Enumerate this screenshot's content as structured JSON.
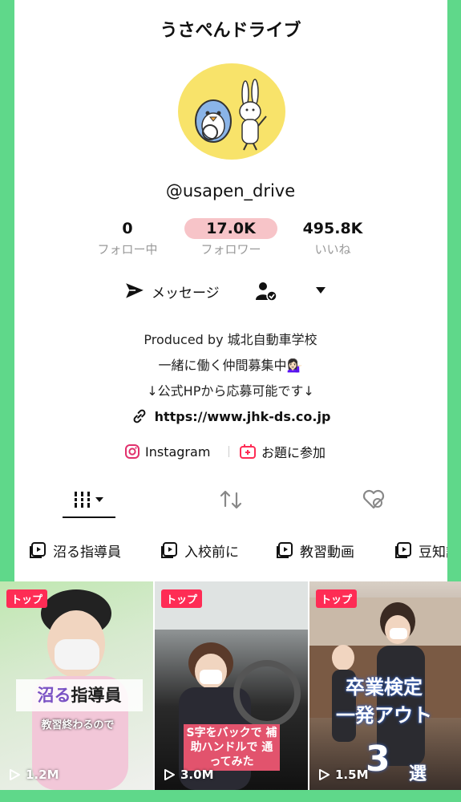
{
  "profile": {
    "display_name": "うさぺんドライブ",
    "handle": "@usapen_drive"
  },
  "stats": {
    "following": {
      "value": "0",
      "label": "フォロー中"
    },
    "followers": {
      "value": "17.0K",
      "label": "フォロワー"
    },
    "likes": {
      "value": "495.8K",
      "label": "いいね"
    }
  },
  "actions": {
    "message_label": "メッセージ"
  },
  "bio": {
    "line1": "Produced by 城北自動車学校",
    "line2": "一緒に働く仲間募集中💁🏻‍♀️",
    "line3": "↓公式HPから応募可能です↓",
    "link": "https://www.jhk-ds.co.jp"
  },
  "badges": {
    "instagram": "Instagram",
    "topic": "お題に参加"
  },
  "tabs": [
    "videos",
    "reposts",
    "liked"
  ],
  "playlists": [
    "沼る指導員",
    "入校前に",
    "教習動画",
    "豆知識"
  ],
  "videos": [
    {
      "pinned_label": "トップ",
      "views": "1.2M",
      "caption_main": "沼る",
      "caption_main2": "指導員",
      "caption_sub": "教習終わるので"
    },
    {
      "pinned_label": "トップ",
      "views": "3.0M",
      "caption_lines": "S字をバックで 補助ハンドルで 通ってみた"
    },
    {
      "pinned_label": "トップ",
      "views": "1.5M",
      "caption_line1": "卒業検定",
      "caption_line2": "一発アウト",
      "caption_num": "3",
      "caption_end": "選"
    }
  ],
  "colors": {
    "frame_green": "#5fd88a",
    "followers_highlight": "#f7c4c8",
    "pin_red": "#fe2c55",
    "avatar_yellow": "#f8e36a"
  }
}
